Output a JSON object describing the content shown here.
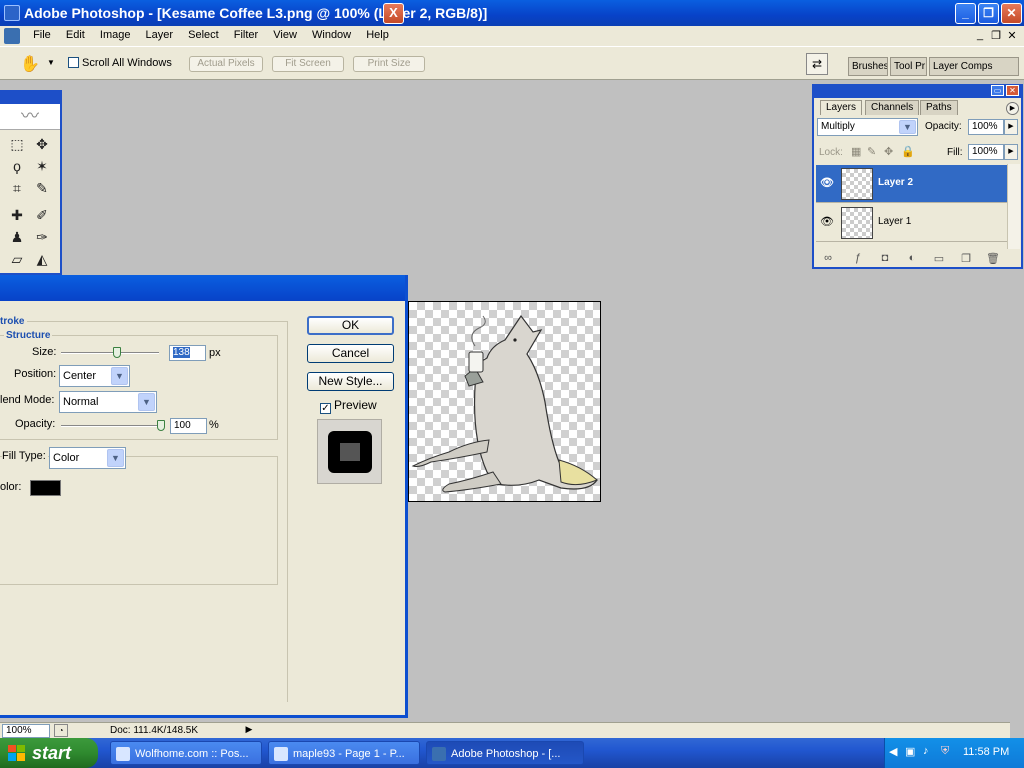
{
  "window": {
    "title": "Adobe Photoshop - [Kesame Coffee L3.png @ 100% (Layer 2, RGB/8)]",
    "min": "_",
    "max": "❐",
    "close": "✕"
  },
  "menu": [
    "File",
    "Edit",
    "Image",
    "Layer",
    "Select",
    "Filter",
    "View",
    "Window",
    "Help"
  ],
  "options": {
    "scroll_all_label": "Scroll All Windows",
    "actual_pixels": "Actual Pixels",
    "fit_screen": "Fit Screen",
    "print_size": "Print Size",
    "well_tabs": [
      "Brushes",
      "Tool Pr",
      "Layer Comps"
    ]
  },
  "dialog": {
    "section_title": "troke",
    "structure_title": "Structure",
    "size_label": "Size:",
    "size_value": "138",
    "size_unit": "px",
    "position_label": "Position:",
    "position_value": "Center",
    "blend_label": "lend Mode:",
    "blend_value": "Normal",
    "opacity_label": "Opacity:",
    "opacity_value": "100",
    "opacity_unit": "%",
    "fill_type_label": "Fill Type:",
    "fill_type_value": "Color",
    "color_label": "olor:",
    "color_value": "#000000",
    "ok": "OK",
    "cancel": "Cancel",
    "new_style": "New Style...",
    "preview": "Preview",
    "close": "X"
  },
  "layers_panel": {
    "tabs": [
      "Layers",
      "Channels",
      "Paths"
    ],
    "blend_mode": "Multiply",
    "opacity_label": "Opacity:",
    "opacity_value": "100%",
    "lock_label": "Lock:",
    "fill_label": "Fill:",
    "fill_value": "100%",
    "layers": [
      {
        "name": "Layer 2",
        "selected": true
      },
      {
        "name": "Layer 1",
        "selected": false
      }
    ]
  },
  "status": {
    "zoom": "100%",
    "doc": "Doc: 111.4K/148.5K"
  },
  "taskbar": {
    "start": "start",
    "tasks": [
      "Wolfhome.com :: Pos...",
      "maple93 - Page 1 - P...",
      "Adobe Photoshop - [..."
    ],
    "time": "11:58 PM"
  }
}
